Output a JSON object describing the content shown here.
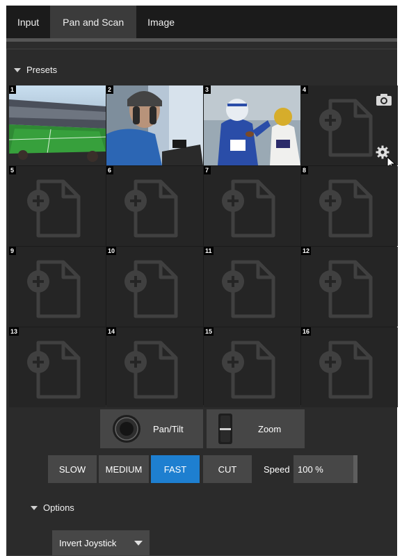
{
  "tabs": [
    {
      "label": "Input"
    },
    {
      "label": "Pan and Scan"
    },
    {
      "label": "Image"
    }
  ],
  "active_tab": "Pan and Scan",
  "presets": {
    "heading": "Presets",
    "slots": [
      {
        "number": "1",
        "state": "thumbnail-stadium"
      },
      {
        "number": "2",
        "state": "thumbnail-camera-operator"
      },
      {
        "number": "3",
        "state": "thumbnail-quarterback"
      },
      {
        "number": "4",
        "state": "empty-hovered"
      },
      {
        "number": "5",
        "state": "empty"
      },
      {
        "number": "6",
        "state": "empty"
      },
      {
        "number": "7",
        "state": "empty"
      },
      {
        "number": "8",
        "state": "empty"
      },
      {
        "number": "9",
        "state": "empty"
      },
      {
        "number": "10",
        "state": "empty"
      },
      {
        "number": "11",
        "state": "empty"
      },
      {
        "number": "12",
        "state": "empty"
      },
      {
        "number": "13",
        "state": "empty"
      },
      {
        "number": "14",
        "state": "empty"
      },
      {
        "number": "15",
        "state": "empty"
      },
      {
        "number": "16",
        "state": "empty"
      }
    ]
  },
  "controls": {
    "pan_tilt_label": "Pan/Tilt",
    "zoom_label": "Zoom",
    "speed_buttons": [
      {
        "label": "SLOW",
        "active": false
      },
      {
        "label": "MEDIUM",
        "active": false
      },
      {
        "label": "FAST",
        "active": true
      },
      {
        "label": "CUT",
        "active": false
      }
    ],
    "speed_label": "Speed",
    "speed_value": "100 %"
  },
  "options": {
    "heading": "Options",
    "invert_joystick_label": "Invert Joystick"
  },
  "colors": {
    "accent": "#1e7fd0",
    "button": "#474747",
    "panel": "#2b2b2b"
  }
}
